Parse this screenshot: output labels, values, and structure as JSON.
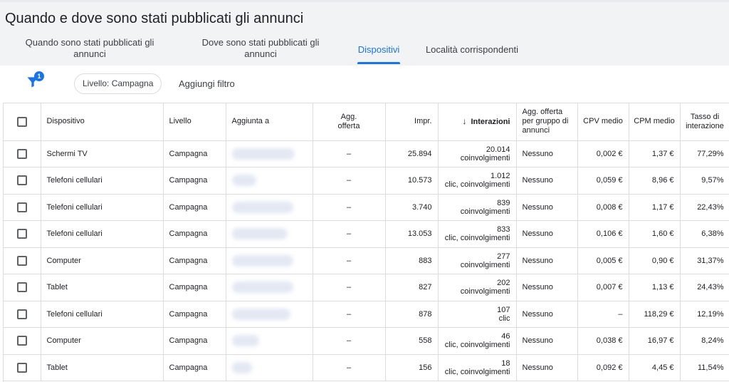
{
  "page": {
    "title": "Quando e dove sono stati pubblicati gli annunci"
  },
  "tabs": [
    {
      "label": "Quando sono stati pubblicati gli annunci"
    },
    {
      "label": "Dove sono stati pubblicati gli annunci"
    },
    {
      "label": "Dispositivi"
    },
    {
      "label": "Località corrispondenti"
    }
  ],
  "filters": {
    "badge_count": "1",
    "chip_label": "Livello: Campagna",
    "add_filter_label": "Aggiungi filtro"
  },
  "table": {
    "headers": {
      "dispositivo": "Dispositivo",
      "livello": "Livello",
      "aggiunta": "Aggiunta a",
      "agg_offerta": "Agg. offerta",
      "impr": "Impr.",
      "interazioni": "Interazioni",
      "agg_gruppo": "Agg. offerta per gruppo di annunci",
      "cpv": "CPV medio",
      "cpm": "CPM medio",
      "tasso": "Tasso di interazione"
    },
    "sort_icon": "arrow-down-icon",
    "rows": [
      {
        "dispositivo": "Schermi TV",
        "livello": "Campagna",
        "agg_offerta": "–",
        "impr": "25.894",
        "interazioni": "20.014",
        "interazioni_tipo": "coinvolgimenti",
        "agg_gruppo": "Nessuno",
        "cpv": "0,002 €",
        "cpm": "1,37 €",
        "tasso": "77,29%"
      },
      {
        "dispositivo": "Telefoni cellulari",
        "livello": "Campagna",
        "agg_offerta": "–",
        "impr": "10.573",
        "interazioni": "1.012",
        "interazioni_tipo": "clic, coinvolgimenti",
        "agg_gruppo": "Nessuno",
        "cpv": "0,059 €",
        "cpm": "8,96 €",
        "tasso": "9,57%"
      },
      {
        "dispositivo": "Telefoni cellulari",
        "livello": "Campagna",
        "agg_offerta": "–",
        "impr": "3.740",
        "interazioni": "839",
        "interazioni_tipo": "coinvolgimenti",
        "agg_gruppo": "Nessuno",
        "cpv": "0,008 €",
        "cpm": "1,17 €",
        "tasso": "22,43%"
      },
      {
        "dispositivo": "Telefoni cellulari",
        "livello": "Campagna",
        "agg_offerta": "–",
        "impr": "13.053",
        "interazioni": "833",
        "interazioni_tipo": "clic, coinvolgimenti",
        "agg_gruppo": "Nessuno",
        "cpv": "0,106 €",
        "cpm": "1,60 €",
        "tasso": "6,38%"
      },
      {
        "dispositivo": "Computer",
        "livello": "Campagna",
        "agg_offerta": "–",
        "impr": "883",
        "interazioni": "277",
        "interazioni_tipo": "coinvolgimenti",
        "agg_gruppo": "Nessuno",
        "cpv": "0,005 €",
        "cpm": "0,90 €",
        "tasso": "31,37%"
      },
      {
        "dispositivo": "Tablet",
        "livello": "Campagna",
        "agg_offerta": "–",
        "impr": "827",
        "interazioni": "202",
        "interazioni_tipo": "coinvolgimenti",
        "agg_gruppo": "Nessuno",
        "cpv": "0,007 €",
        "cpm": "1,13 €",
        "tasso": "24,43%"
      },
      {
        "dispositivo": "Telefoni cellulari",
        "livello": "Campagna",
        "agg_offerta": "–",
        "impr": "878",
        "interazioni": "107",
        "interazioni_tipo": "clic",
        "agg_gruppo": "Nessuno",
        "cpv": "–",
        "cpm": "118,29 €",
        "tasso": "12,19%"
      },
      {
        "dispositivo": "Computer",
        "livello": "Campagna",
        "agg_offerta": "–",
        "impr": "558",
        "interazioni": "46",
        "interazioni_tipo": "clic, coinvolgimenti",
        "agg_gruppo": "Nessuno",
        "cpv": "0,038 €",
        "cpm": "16,97 €",
        "tasso": "8,24%"
      },
      {
        "dispositivo": "Tablet",
        "livello": "Campagna",
        "agg_offerta": "–",
        "impr": "156",
        "interazioni": "18",
        "interazioni_tipo": "clic, coinvolgimenti",
        "agg_gruppo": "Nessuno",
        "cpv": "0,092 €",
        "cpm": "4,45 €",
        "tasso": "11,54%"
      }
    ]
  },
  "colors": {
    "accent": "#1a73e8",
    "header_bg": "#f1f3f4",
    "border": "#dadce0"
  }
}
